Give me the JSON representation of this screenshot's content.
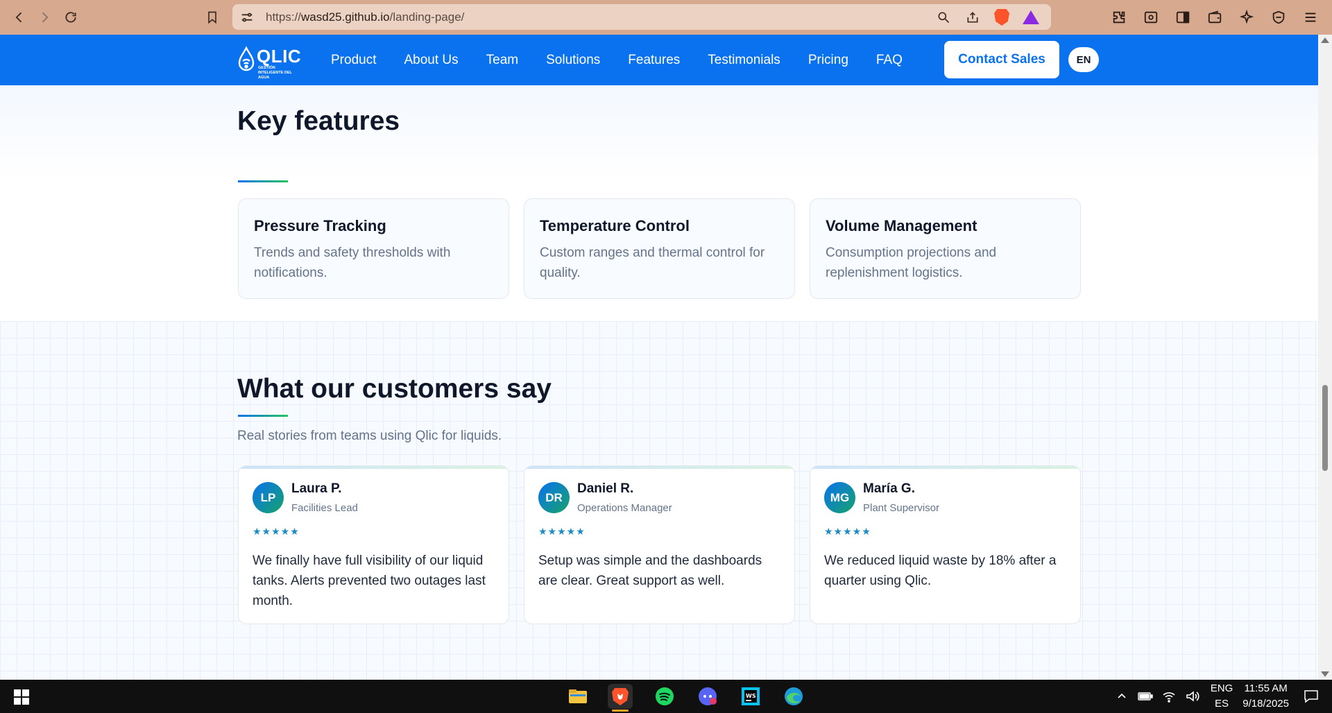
{
  "browser": {
    "url_prefix": "https://",
    "url_host": "wasd25.github.io",
    "url_path": "/landing-page/"
  },
  "nav": {
    "logo_text": "QLIC",
    "logo_tagline": "GESTIÓN INTELIGENTE DEL AGUA",
    "items": [
      "Product",
      "About Us",
      "Team",
      "Solutions",
      "Features",
      "Testimonials",
      "Pricing",
      "FAQ"
    ],
    "contact_label": "Contact Sales",
    "language": "EN"
  },
  "features": {
    "title": "Key features",
    "cards": [
      {
        "title": "Pressure Tracking",
        "desc": "Trends and safety thresholds with notifications."
      },
      {
        "title": "Temperature Control",
        "desc": "Custom ranges and thermal control for quality."
      },
      {
        "title": "Volume Management",
        "desc": "Consumption projections and replenishment logistics."
      }
    ]
  },
  "testimonials": {
    "title": "What our customers say",
    "subtitle": "Real stories from teams using Qlic for liquids.",
    "cards": [
      {
        "initials": "LP",
        "name": "Laura P.",
        "role": "Facilities Lead",
        "stars": "★★★★★",
        "quote": "We finally have full visibility of our liquid tanks. Alerts prevented two outages last month."
      },
      {
        "initials": "DR",
        "name": "Daniel R.",
        "role": "Operations Manager",
        "stars": "★★★★★",
        "quote": "Setup was simple and the dashboards are clear. Great support as well."
      },
      {
        "initials": "MG",
        "name": "María G.",
        "role": "Plant Supervisor",
        "stars": "★★★★★",
        "quote": "We reduced liquid waste by 18% after a quarter using Qlic."
      }
    ]
  },
  "taskbar": {
    "lang_top": "ENG",
    "lang_bottom": "ES",
    "time": "11:55 AM",
    "date": "9/18/2025"
  },
  "colors": {
    "brand_blue": "#0a72ef",
    "browser_frame": "#d7a98f",
    "accent_green": "#22c55e"
  }
}
